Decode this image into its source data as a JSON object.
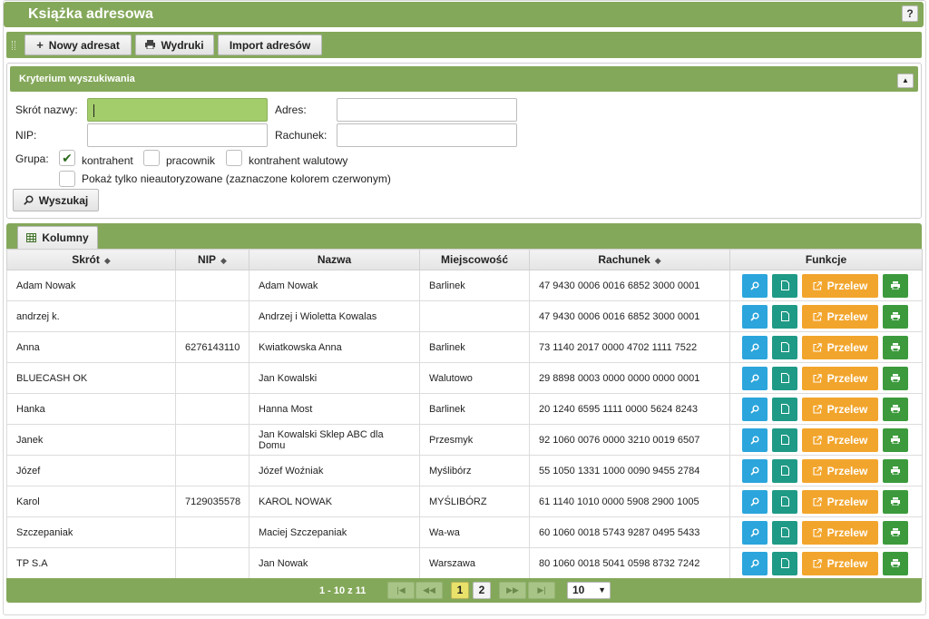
{
  "app": {
    "title": "Książka adresowa",
    "help_label": "?"
  },
  "toolbar": {
    "new_label": "Nowy adresat",
    "print_label": "Wydruki",
    "import_label": "Import adresów"
  },
  "search": {
    "panel_title": "Kryterium wyszukiwania",
    "collapse_label": "▲",
    "shortname_label": "Skrót nazwy:",
    "shortname_value": "",
    "address_label": "Adres:",
    "address_value": "",
    "nip_label": "NIP:",
    "nip_value": "",
    "account_label": "Rachunek:",
    "account_value": "",
    "group_label": "Grupa:",
    "groups": [
      {
        "label": "kontrahent",
        "checked": true
      },
      {
        "label": "pracownik",
        "checked": false
      },
      {
        "label": "kontrahent walutowy",
        "checked": false
      }
    ],
    "unauthorized_label": "Pokaż tylko nieautoryzowane (zaznaczone kolorem czerwonym)",
    "unauthorized_checked": false,
    "search_button": "Wyszukaj"
  },
  "table": {
    "columns_button": "Kolumny",
    "headers": {
      "shortname": "Skrót",
      "nip": "NIP",
      "name": "Nazwa",
      "city": "Miejscowość",
      "account": "Rachunek",
      "functions": "Funkcje"
    },
    "transfer_label": "Przelew",
    "rows": [
      {
        "shortname": "Adam Nowak",
        "nip": "",
        "name": "Adam Nowak",
        "city": "Barlinek",
        "account": "47 9430 0006 0016 6852 3000 0001"
      },
      {
        "shortname": "andrzej k.",
        "nip": "",
        "name": "Andrzej i Wioletta Kowalas",
        "city": "",
        "account": "47 9430 0006 0016 6852 3000 0001"
      },
      {
        "shortname": "Anna",
        "nip": "6276143110",
        "name": "Kwiatkowska Anna",
        "city": "Barlinek",
        "account": "73 1140 2017 0000 4702 1111 7522"
      },
      {
        "shortname": "BLUECASH OK",
        "nip": "",
        "name": "Jan Kowalski",
        "city": "Walutowo",
        "account": "29 8898 0003 0000 0000 0000 0001"
      },
      {
        "shortname": "Hanka",
        "nip": "",
        "name": "Hanna Most",
        "city": "Barlinek",
        "account": "20 1240 6595 1111 0000 5624 8243"
      },
      {
        "shortname": "Janek",
        "nip": "",
        "name": "Jan Kowalski Sklep ABC dla Domu",
        "city": "Przesmyk",
        "account": "92 1060 0076 0000 3210 0019 6507"
      },
      {
        "shortname": "Józef",
        "nip": "",
        "name": "Józef Woźniak",
        "city": "Myślibórz",
        "account": "55 1050 1331 1000 0090 9455 2784"
      },
      {
        "shortname": "Karol",
        "nip": "7129035578",
        "name": "KAROL NOWAK",
        "city": "MYŚLIBÓRZ",
        "account": "61 1140 1010 0000 5908 2900 1005"
      },
      {
        "shortname": "Szczepaniak",
        "nip": "",
        "name": "Maciej Szczepaniak",
        "city": "Wa-wa",
        "account": "60 1060 0018 5743 9287 0495 5433"
      },
      {
        "shortname": "TP S.A",
        "nip": "",
        "name": "Jan Nowak",
        "city": "Warszawa",
        "account": "80 1060 0018 5041 0598 8732 7242"
      }
    ]
  },
  "pager": {
    "info": "1 - 10 z 11",
    "first_label": "|◀",
    "prev_label": "◀◀",
    "pages": [
      "1",
      "2"
    ],
    "current_page": "1",
    "next_label": "▶▶",
    "last_label": "▶|",
    "page_size": "10"
  },
  "colors": {
    "accent_green": "#84a85a",
    "active_input": "#a3cc6b",
    "transfer_orange": "#f2a52c",
    "preview_blue": "#2ba5dc",
    "doc_teal": "#1f9a86",
    "print_green": "#3c9a3c"
  }
}
